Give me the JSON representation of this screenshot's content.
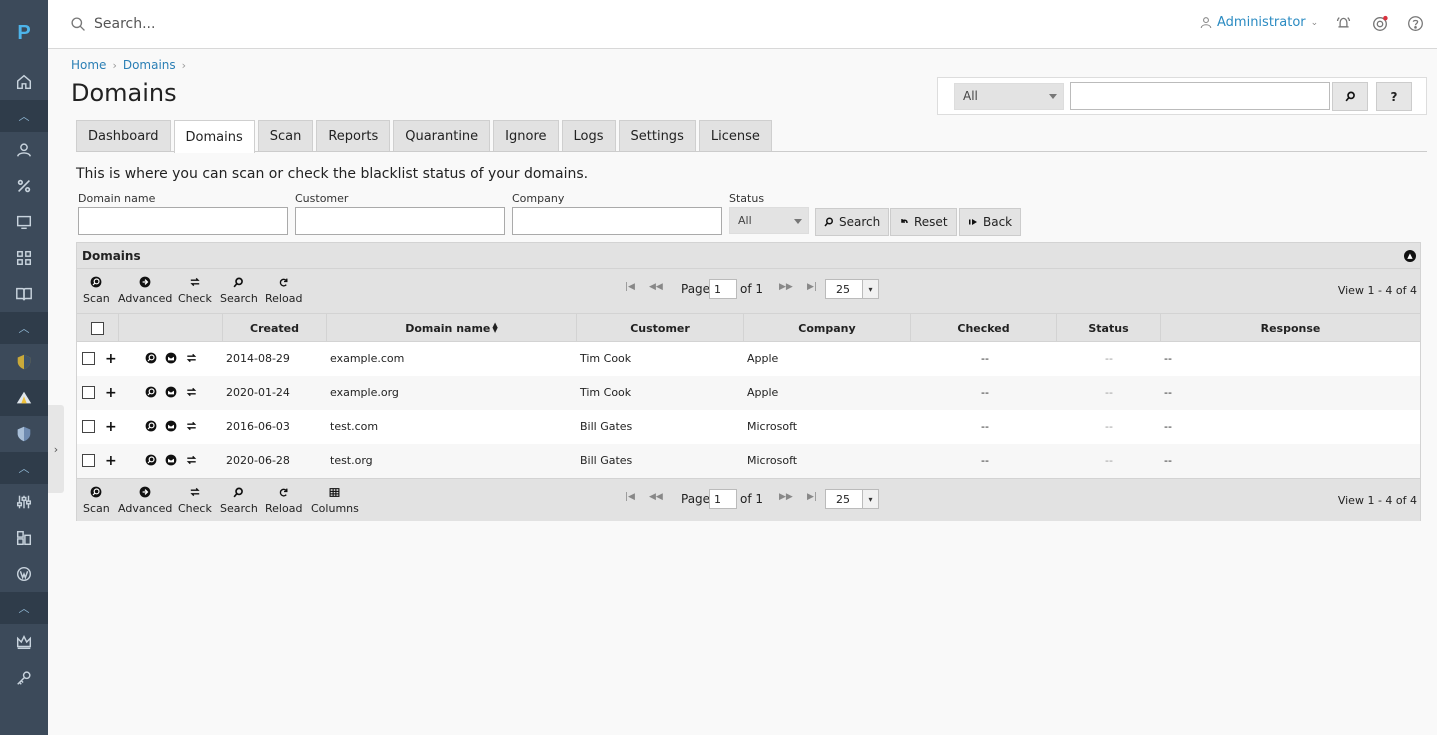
{
  "app": {
    "logo": "P"
  },
  "topbar": {
    "search_placeholder": "Search...",
    "user": "Administrator"
  },
  "breadcrumb": [
    "Home",
    "Domains"
  ],
  "page_title": "Domains",
  "quick_search": {
    "scope": "All",
    "help_label": "?"
  },
  "tabs": [
    "Dashboard",
    "Domains",
    "Scan",
    "Reports",
    "Quarantine",
    "Ignore",
    "Logs",
    "Settings",
    "License"
  ],
  "active_tab": "Domains",
  "intro": "This is where you can scan or check the blacklist status of your domains.",
  "filters": {
    "domain_label": "Domain name",
    "customer_label": "Customer",
    "company_label": "Company",
    "status_label": "Status",
    "status_value": "All",
    "search_btn": "Search",
    "reset_btn": "Reset",
    "back_btn": "Back"
  },
  "grid": {
    "caption": "Domains",
    "toolbar_top": [
      "Scan",
      "Advanced",
      "Check",
      "Search",
      "Reload"
    ],
    "toolbar_bottom": [
      "Scan",
      "Advanced",
      "Check",
      "Search",
      "Reload",
      "Columns"
    ],
    "page_label": "Page",
    "page_value": "1",
    "of_label": "of 1",
    "page_size": "25",
    "view_text": "View 1 - 4 of 4",
    "columns": [
      "Created",
      "Domain name",
      "Customer",
      "Company",
      "Checked",
      "Status",
      "Response"
    ],
    "rows": [
      {
        "created": "2014-08-29",
        "domain": "example.com",
        "customer": "Tim Cook",
        "company": "Apple",
        "checked": "--",
        "status": "--",
        "response": "--"
      },
      {
        "created": "2020-01-24",
        "domain": "example.org",
        "customer": "Tim Cook",
        "company": "Apple",
        "checked": "--",
        "status": "--",
        "response": "--"
      },
      {
        "created": "2016-06-03",
        "domain": "test.com",
        "customer": "Bill Gates",
        "company": "Microsoft",
        "checked": "--",
        "status": "--",
        "response": "--"
      },
      {
        "created": "2020-06-28",
        "domain": "test.org",
        "customer": "Bill Gates",
        "company": "Microsoft",
        "checked": "--",
        "status": "--",
        "response": "--"
      }
    ]
  },
  "colors": {
    "rail": "#3c4a5a",
    "rail_dark": "#2f3c4a",
    "link": "#2b7fb5",
    "logo": "#4db4ea"
  }
}
